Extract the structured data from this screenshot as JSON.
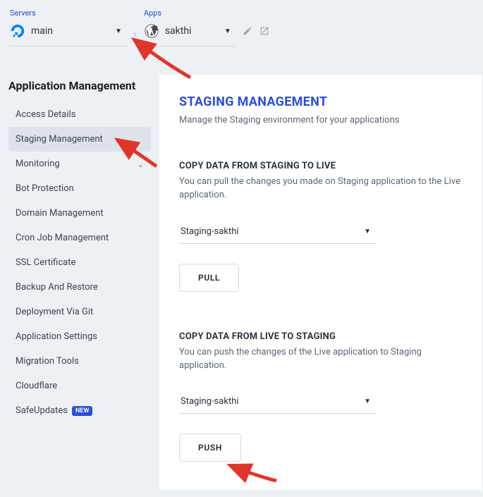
{
  "top": {
    "servers_label": "Servers",
    "server_name": "main",
    "apps_label": "Apps",
    "app_name": "sakthi"
  },
  "sidebar": {
    "title": "Application Management",
    "items": [
      {
        "label": "Access Details",
        "active": false
      },
      {
        "label": "Staging Management",
        "active": true
      },
      {
        "label": "Monitoring",
        "active": false,
        "expand": true
      },
      {
        "label": "Bot Protection",
        "active": false
      },
      {
        "label": "Domain Management",
        "active": false
      },
      {
        "label": "Cron Job Management",
        "active": false
      },
      {
        "label": "SSL Certificate",
        "active": false
      },
      {
        "label": "Backup And Restore",
        "active": false
      },
      {
        "label": "Deployment Via Git",
        "active": false
      },
      {
        "label": "Application Settings",
        "active": false
      },
      {
        "label": "Migration Tools",
        "active": false
      },
      {
        "label": "Cloudflare",
        "active": false
      },
      {
        "label": "SafeUpdates",
        "active": false,
        "badge": "NEW"
      }
    ]
  },
  "page": {
    "title": "STAGING MANAGEMENT",
    "subtitle": "Manage the Staging environment for your applications"
  },
  "section_pull": {
    "title": "COPY DATA FROM STAGING TO LIVE",
    "desc": "You can pull the changes you made on Staging application to the Live application.",
    "selected": "Staging-sakthi",
    "button": "PULL"
  },
  "section_push": {
    "title": "COPY DATA FROM LIVE TO STAGING",
    "desc": "You can push the changes of the Live application to Staging application.",
    "selected": "Staging-sakthi",
    "button": "PUSH"
  }
}
